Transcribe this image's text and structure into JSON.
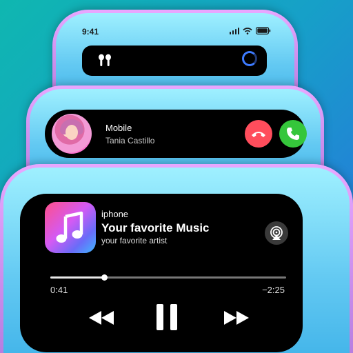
{
  "status_bar": {
    "time": "9:41"
  },
  "incoming_call": {
    "caller_type": "Mobile",
    "caller_name": "Tania Castillo"
  },
  "now_playing": {
    "source": "iphone",
    "title": "Your favorite Music",
    "artist": "your favorite artist",
    "elapsed": "0:41",
    "remaining": "−2:25",
    "progress_fraction": 0.23
  },
  "colors": {
    "decline": "#ff4d5c",
    "accept": "#35c63b",
    "frame": "#c48ff0",
    "background_start": "#0fb7b0",
    "background_end": "#2b6fe0"
  },
  "icons": [
    "airpods-icon",
    "activity-ring-icon",
    "signal-icon",
    "wifi-icon",
    "battery-icon",
    "phone-decline-icon",
    "phone-accept-icon",
    "music-note-icon",
    "airplay-icon",
    "rewind-icon",
    "pause-icon",
    "fast-forward-icon"
  ]
}
